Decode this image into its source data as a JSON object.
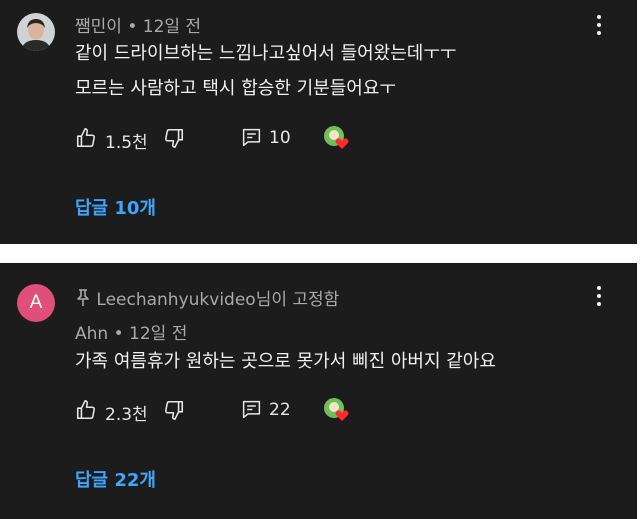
{
  "comments": [
    {
      "author": "쨈민이",
      "time": "• 12일 전",
      "lines": [
        "같이 드라이브하는 느낌나고싶어서 들어왔는데ㅜㅜ",
        "모르는 사람하고 택시 합승한 기분들어요ㅜ"
      ],
      "likes": "1.5천",
      "reply_count": "10",
      "replies_label": "답글 10개",
      "avatar_icon": "person-photo-avatar"
    },
    {
      "pinned_label": "Leechanhyukvideo님이 고정함",
      "author": "Ahn",
      "time": "• 12일 전",
      "text": "가족 여름휴가 원하는 곳으로 못가서 삐진 아버지 같아요",
      "likes": "2.3천",
      "reply_count": "22",
      "replies_label": "답글 22개",
      "avatar_letter": "A",
      "avatar_color": "#e04e7b"
    }
  ],
  "colors": {
    "card_bg": "#1c1c1c",
    "link": "#3ea6ff",
    "separator": "#ffffff"
  }
}
